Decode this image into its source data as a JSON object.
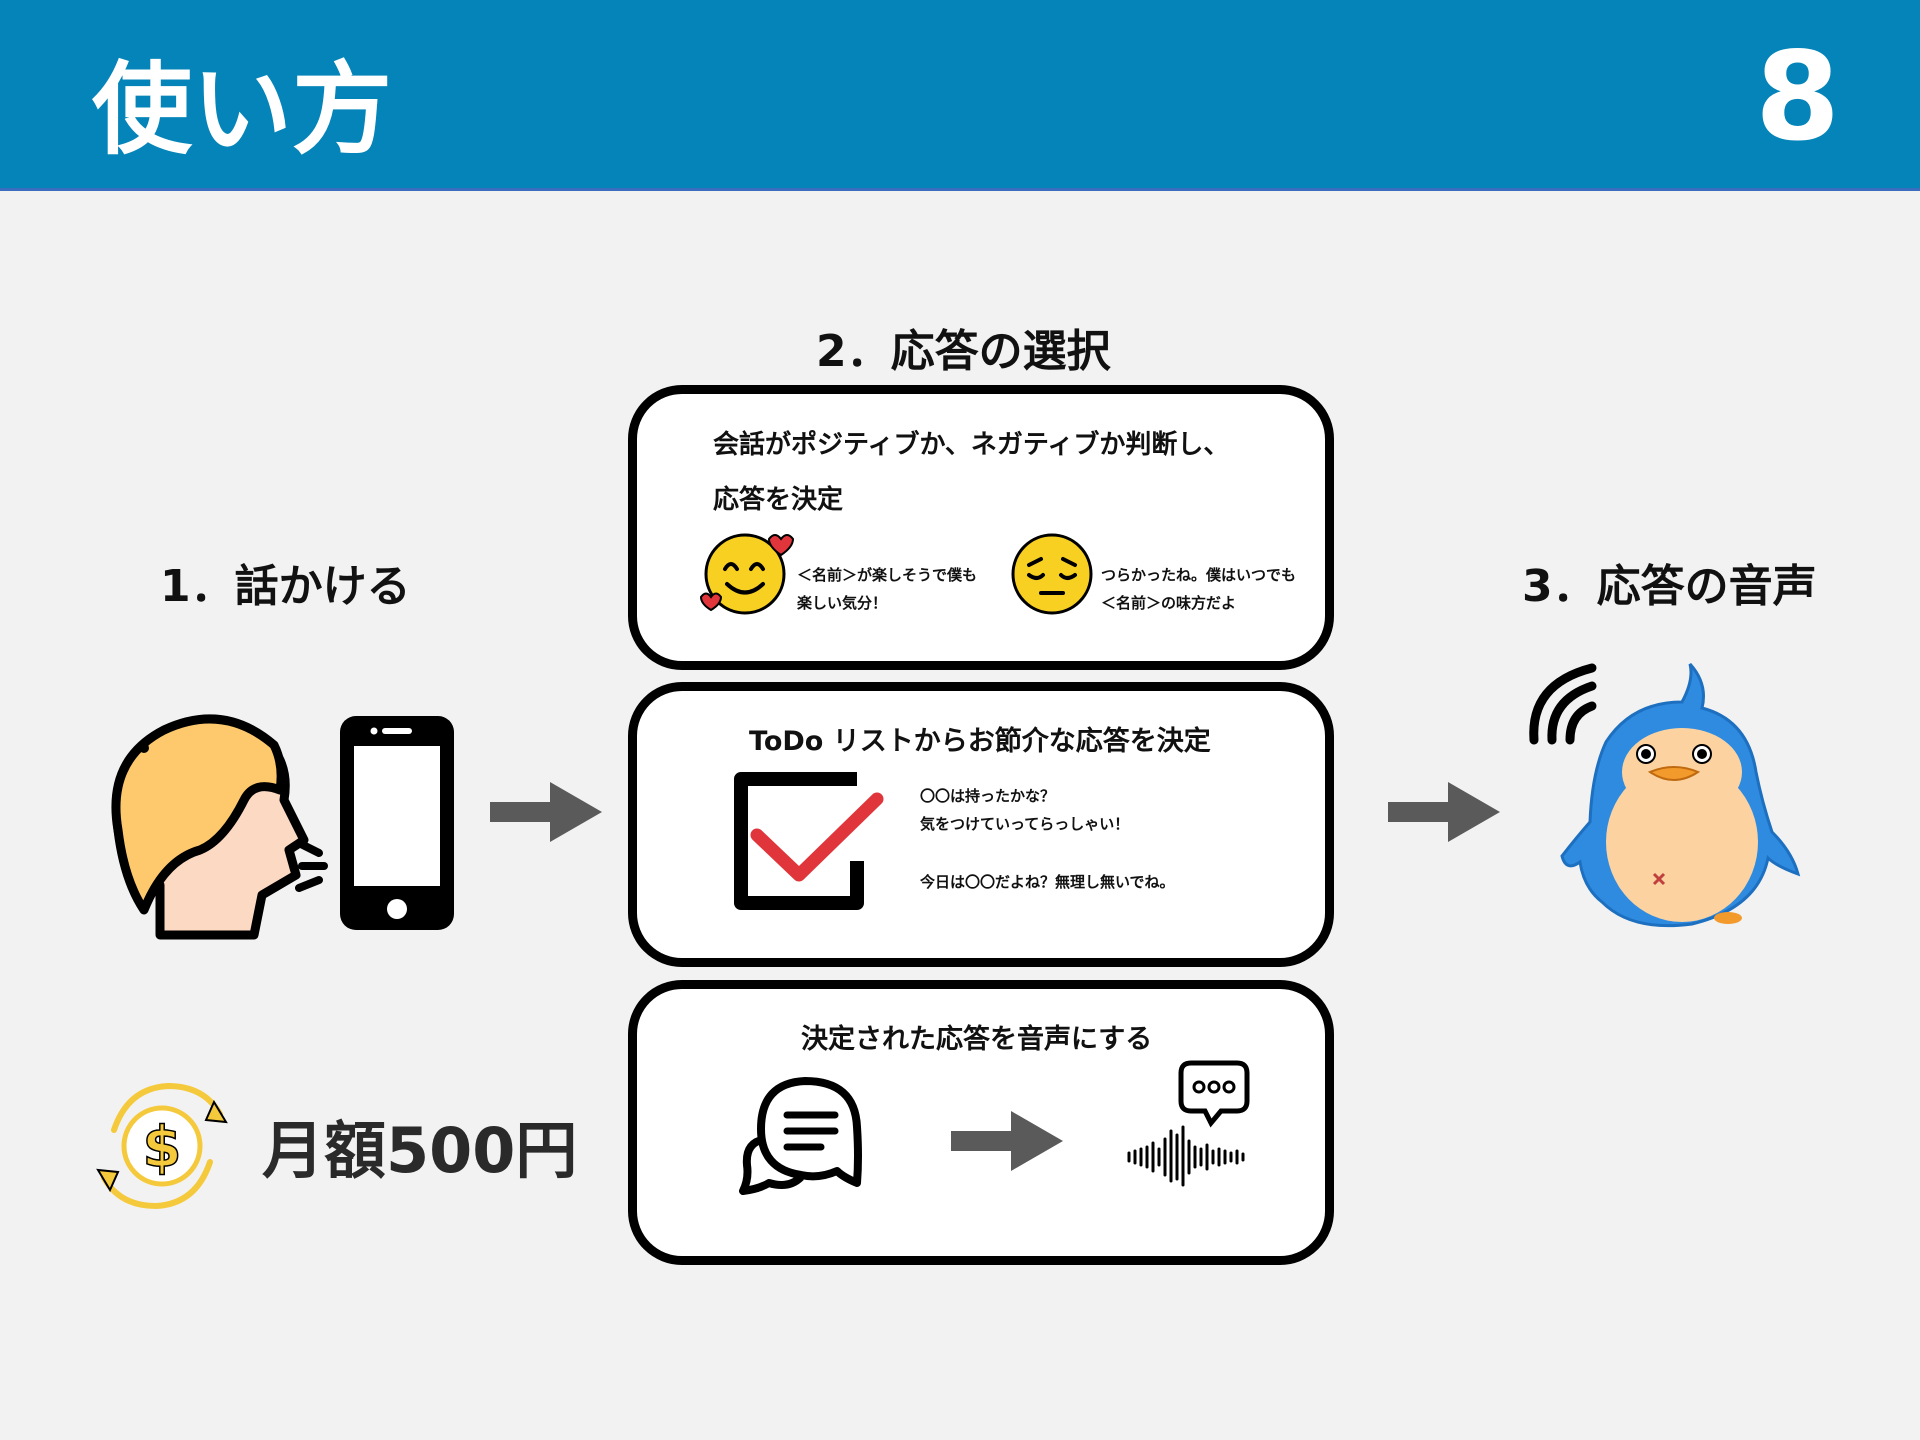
{
  "header": {
    "title": "使い方",
    "page_number": "8"
  },
  "steps": {
    "step1": "1．話かける",
    "step2": "2．応答の選択",
    "step3": "3．応答の音声"
  },
  "box1": {
    "line1": "会話がポジティブか、ネガティブか判断し、",
    "line2": "応答を決定",
    "positive_line1": "＜名前＞が楽しそうで僕も",
    "positive_line2": "楽しい気分！",
    "negative_line1": "つらかったね。僕はいつでも",
    "negative_line2": "＜名前＞の味方だよ"
  },
  "box2": {
    "title": "ToDo リストからお節介な応答を決定",
    "line1": "〇〇は持ったかな？",
    "line2": "気をつけていってらっしゃい！",
    "line3": "今日は〇〇だよね？無理し無いでね。"
  },
  "box3": {
    "title": "決定された応答を音声にする"
  },
  "price": {
    "label": "月額500円"
  },
  "colors": {
    "header_bg": "#0484b8",
    "arrow": "#5a5a5a",
    "check_red": "#e0353b",
    "emoji_yellow": "#f7d021",
    "penguin_blue": "#2f8be0",
    "coin_yellow": "#f5c93c"
  }
}
